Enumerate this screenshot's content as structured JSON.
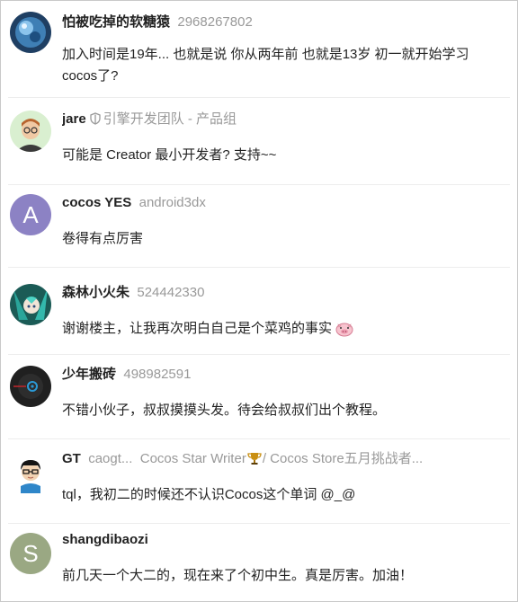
{
  "posts": [
    {
      "username": "怕被吃掉的软糖猿",
      "title": "2968267802",
      "body": "加入时间是19年... 也就是说 你从两年前 也就是13岁 初一就开始学习cocos了?",
      "avatar": "blue-sphere-avatar"
    },
    {
      "username": "jare",
      "title": "引擎开发团队 - 产品组",
      "body": "可能是 Creator 最小开发者? 支持~~",
      "avatar": "cartoon-man-glasses-avatar",
      "badge_icon": "shield-icon"
    },
    {
      "username": "cocos YES",
      "title": "android3dx",
      "body": "卷得有点厉害",
      "avatar_letter": "A",
      "avatar_color": "#8c82c4"
    },
    {
      "username": "森林小火朱",
      "title": "524442330",
      "body": "谢谢楼主，让我再次明白自己是个菜鸡的事实",
      "avatar": "anime-character-avatar",
      "emoji": "pig-face-icon"
    },
    {
      "username": "少年搬砖",
      "title": "498982591",
      "body": "不错小伙子，叔叔摸摸头发。待会给叔叔们出个教程。",
      "avatar": "dark-gear-avatar"
    },
    {
      "username": "GT",
      "handle": "caogt...",
      "title_a": "Cocos Star Writer",
      "title_b": "/ Cocos Store五月挑战者...",
      "body": "tql，我初二的时候还不认识Cocos这个单词 @_@",
      "avatar": "boy-with-glasses-avatar",
      "title_icon": "trophy-icon"
    },
    {
      "username": "shangdibaozi",
      "body": "前几天一个大二的，现在来了个初中生。真是厉害。加油！",
      "avatar_letter": "S",
      "avatar_color": "#9aa883"
    }
  ]
}
